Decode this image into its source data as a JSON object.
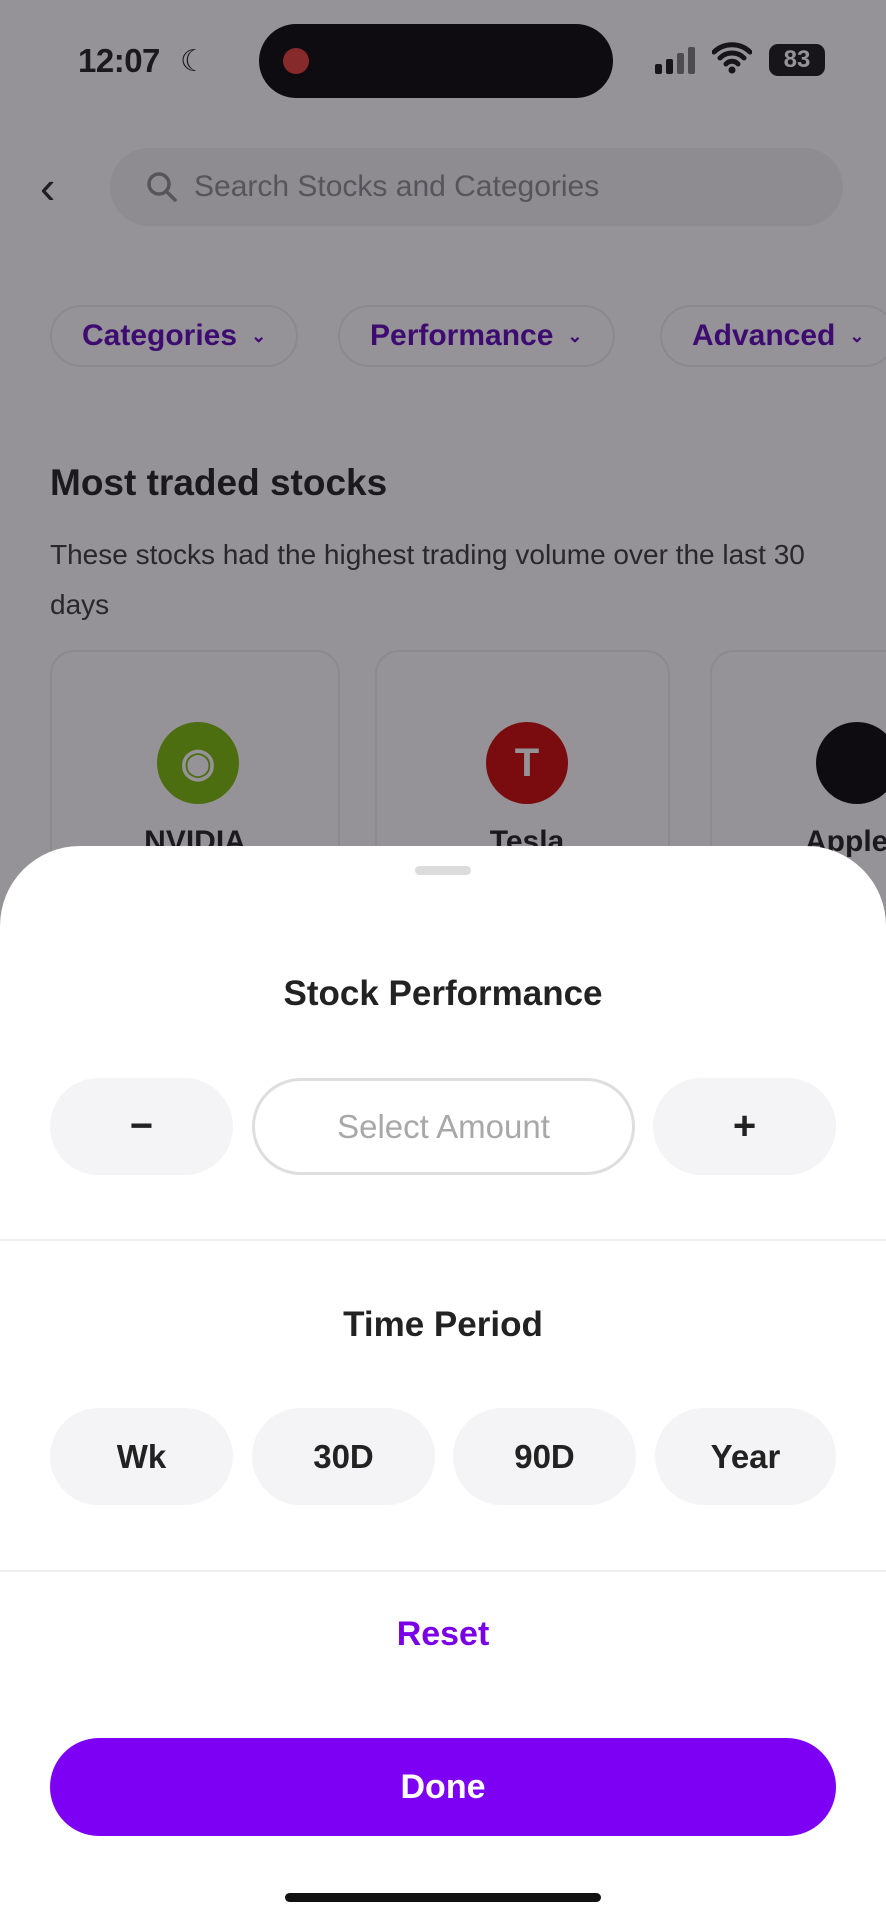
{
  "status_bar": {
    "time": "12:07",
    "battery": "83"
  },
  "search": {
    "placeholder": "Search Stocks and Categories"
  },
  "filters": [
    {
      "label": "Categories"
    },
    {
      "label": "Performance"
    },
    {
      "label": "Advanced"
    }
  ],
  "section": {
    "title": "Most traded stocks",
    "description": "These stocks had the highest trading volume over the last 30 days"
  },
  "stocks": [
    {
      "name": "NVIDIA",
      "color": "#76b900"
    },
    {
      "name": "Tesla",
      "color": "#cc0000"
    },
    {
      "name": "Apple",
      "color": "#000000"
    }
  ],
  "sheet": {
    "title": "Stock Performance",
    "amount_placeholder": "Select Amount",
    "minus": "−",
    "plus": "+",
    "time_title": "Time Period",
    "periods": [
      "Wk",
      "30D",
      "90D",
      "Year"
    ],
    "reset": "Reset",
    "done": "Done"
  },
  "colors": {
    "accent": "#7d00f5",
    "chip_text": "#5b00b8"
  }
}
